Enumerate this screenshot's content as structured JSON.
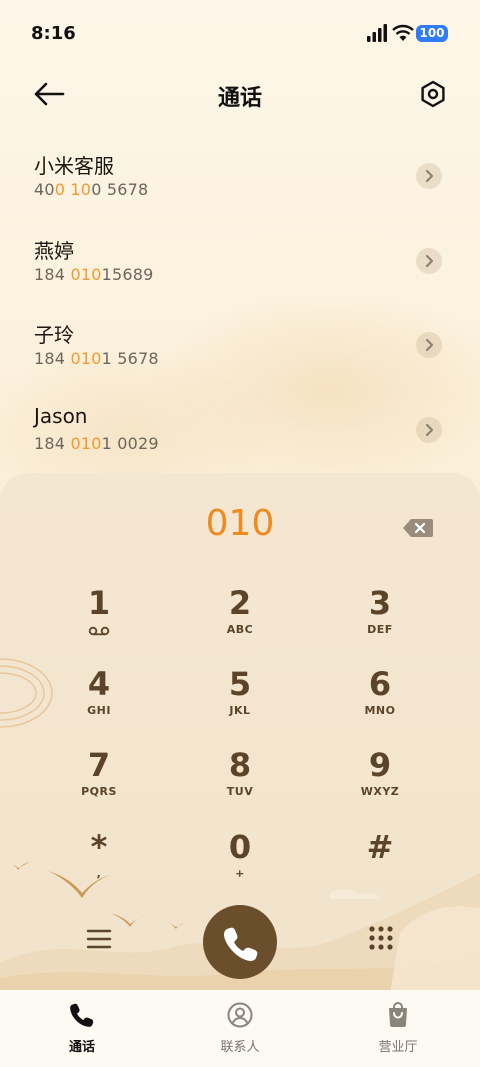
{
  "status_bar": {
    "time": "8:16",
    "battery": "100",
    "icons": [
      "signal-icon",
      "wifi-icon",
      "battery-icon"
    ]
  },
  "header": {
    "title": "通话",
    "back_icon": "arrow-left-icon",
    "settings_icon": "settings-hexagon-icon"
  },
  "results": [
    {
      "name": "小米客服",
      "number_parts": [
        "40",
        "0 10",
        "0 5678"
      ]
    },
    {
      "name": "燕婷",
      "number_parts": [
        "184 ",
        "010",
        "15689"
      ]
    },
    {
      "name": "子玲",
      "number_parts": [
        "184 ",
        "010",
        "1 5678"
      ]
    },
    {
      "name": "Jason",
      "number_parts": [
        "184 ",
        "010",
        "1 0029"
      ]
    }
  ],
  "dialer": {
    "entry": "010",
    "keys": [
      {
        "digit": "1",
        "letters": ""
      },
      {
        "digit": "2",
        "letters": "ABC"
      },
      {
        "digit": "3",
        "letters": "DEF"
      },
      {
        "digit": "4",
        "letters": "GHI"
      },
      {
        "digit": "5",
        "letters": "JKL"
      },
      {
        "digit": "6",
        "letters": "MNO"
      },
      {
        "digit": "7",
        "letters": "PQRS"
      },
      {
        "digit": "8",
        "letters": "TUV"
      },
      {
        "digit": "9",
        "letters": "WXYZ"
      },
      {
        "digit": "*",
        "letters": ","
      },
      {
        "digit": "0",
        "letters": "+"
      },
      {
        "digit": "#",
        "letters": ""
      }
    ]
  },
  "bottom_nav": {
    "tabs": [
      {
        "label": "通话",
        "icon": "phone-icon",
        "active": true
      },
      {
        "label": "联系人",
        "icon": "contact-icon",
        "active": false
      },
      {
        "label": "营业厅",
        "icon": "shopping-bag-icon",
        "active": false
      }
    ]
  },
  "colors": {
    "highlight": "#f59a2a",
    "entry": "#f08a1e",
    "key_text": "#5b4429",
    "call_button": "#6b4f2c"
  }
}
